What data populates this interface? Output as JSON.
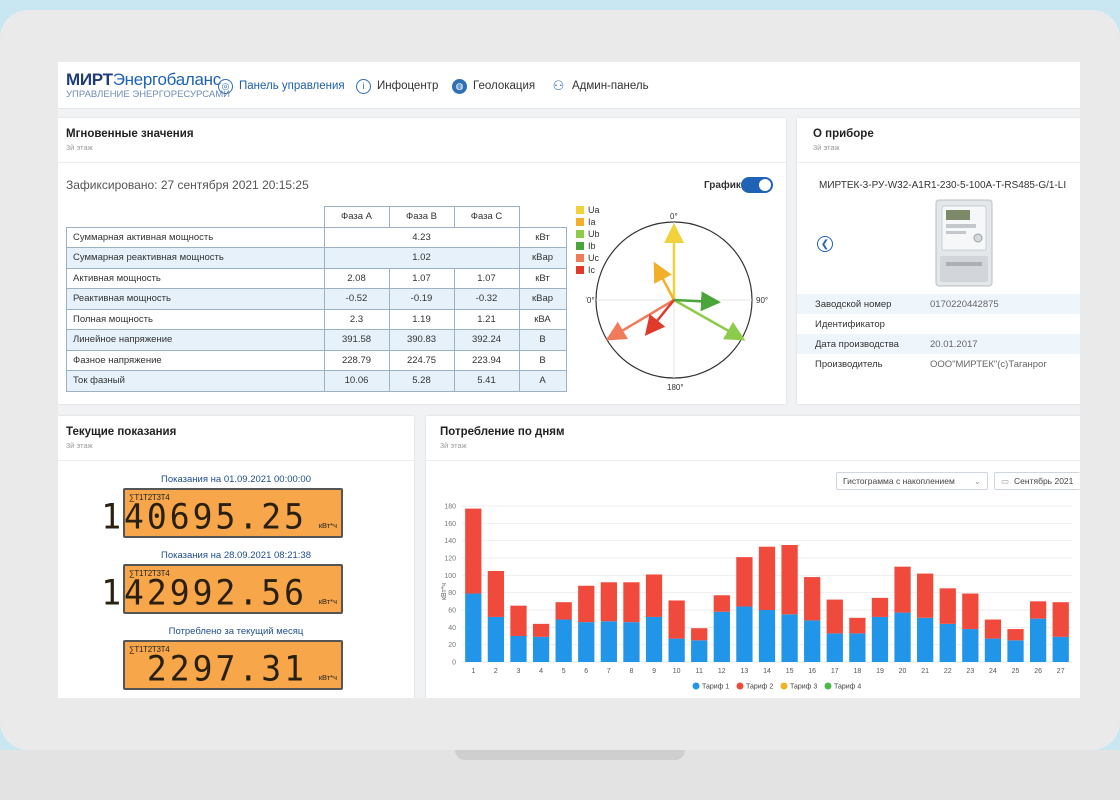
{
  "brand": {
    "name_bold": "МИРТ",
    "name_rest": "Энергобаланс",
    "tagline": "УПРАВЛЕНИЕ ЭНЕРГОРЕСУРСАМИ"
  },
  "nav": [
    {
      "label": "Панель управления",
      "icon": "dashboard-icon"
    },
    {
      "label": "Инфоцентр",
      "icon": "info-icon"
    },
    {
      "label": "Геолокация",
      "icon": "globe-icon"
    },
    {
      "label": "Админ-панель",
      "icon": "users-icon"
    }
  ],
  "instant": {
    "title": "Мгновенные значения",
    "subtitle": "3й этаж",
    "fixed": "Зафиксировано: 27 сентября 2021 20:15:25",
    "graph_label": "График",
    "graph_on": true,
    "headers": [
      "Фаза А",
      "Фаза В",
      "Фаза С"
    ],
    "rows": [
      {
        "name": "Суммарная активная мощность",
        "total": "4.23",
        "unit": "кВт"
      },
      {
        "name": "Суммарная реактивная мощность",
        "total": "1.02",
        "unit": "кВар"
      },
      {
        "name": "Активная мощность",
        "a": "2.08",
        "b": "1.07",
        "c": "1.07",
        "unit": "кВт"
      },
      {
        "name": "Реактивная мощность",
        "a": "-0.52",
        "b": "-0.19",
        "c": "-0.32",
        "unit": "кВар"
      },
      {
        "name": "Полная мощность",
        "a": "2.3",
        "b": "1.19",
        "c": "1.21",
        "unit": "кВА"
      },
      {
        "name": "Линейное напряжение",
        "a": "391.58",
        "b": "390.83",
        "c": "392.24",
        "unit": "В"
      },
      {
        "name": "Фазное напряжение",
        "a": "228.79",
        "b": "224.75",
        "c": "223.94",
        "unit": "В"
      },
      {
        "name": "Ток фазный",
        "a": "10.06",
        "b": "5.28",
        "c": "5.41",
        "unit": "А"
      }
    ],
    "vector_legend": [
      {
        "label": "Ua",
        "color": "#f2d23a"
      },
      {
        "label": "Ia",
        "color": "#f2b02a"
      },
      {
        "label": "Ub",
        "color": "#8ccc4a"
      },
      {
        "label": "Ib",
        "color": "#49a53a"
      },
      {
        "label": "Uc",
        "color": "#f07a5a"
      },
      {
        "label": "Ic",
        "color": "#e03a2a"
      }
    ],
    "vector_angles": [
      "0°",
      "90°",
      "180°",
      "270°"
    ]
  },
  "device": {
    "title": "О приборе",
    "subtitle": "3й этаж",
    "model": "МИРТЕК-3-РУ-W32-A1R1-230-5-100A-T-RS485-G/1-LI",
    "fields": [
      {
        "key": "Заводской номер",
        "value": "0170220442875"
      },
      {
        "key": "Идентификатор",
        "value": ""
      },
      {
        "key": "Дата производства",
        "value": "20.01.2017"
      },
      {
        "key": "Производитель",
        "value": "ООО\"МИРТЕК\"(с)Таганрог"
      }
    ]
  },
  "readings": {
    "title": "Текущие показания",
    "subtitle": "3й этаж",
    "items": [
      {
        "label": "Показания на 01.09.2021 00:00:00",
        "tariff": "∑T1T2T3T4",
        "value": "140695.25",
        "unit": "кВт*ч"
      },
      {
        "label": "Показания на 28.09.2021 08:21:38",
        "tariff": "∑T1T2T3T4",
        "value": "142992.56",
        "unit": "кВт*ч"
      },
      {
        "label": "Потреблено за текущий месяц",
        "tariff": "∑T1T2T3T4",
        "value": "2297.31",
        "unit": "кВт*ч"
      }
    ]
  },
  "consumption": {
    "title": "Потребление по дням",
    "subtitle": "3й этаж",
    "chart_type_select": "Гистограмма с накоплением",
    "month_select": "Сентябрь 2021",
    "colors": {
      "t1": "#2196e8",
      "t2": "#f04a3c",
      "t3": "#f2b022",
      "t4": "#4cb848"
    }
  },
  "chart_data": {
    "type": "bar",
    "stacked": true,
    "categories": [
      "1",
      "2",
      "3",
      "4",
      "5",
      "6",
      "7",
      "8",
      "9",
      "10",
      "11",
      "12",
      "13",
      "14",
      "15",
      "16",
      "17",
      "18",
      "19",
      "20",
      "21",
      "22",
      "23",
      "24",
      "25",
      "26",
      "27"
    ],
    "series": [
      {
        "name": "Тариф 1",
        "values": [
          79,
          52,
          30,
          29,
          49,
          46,
          47,
          46,
          52,
          27,
          25,
          58,
          64,
          60,
          55,
          48,
          33,
          33,
          52,
          57,
          51,
          44,
          38,
          27,
          25,
          50,
          29
        ]
      },
      {
        "name": "Тариф 2",
        "values": [
          98,
          53,
          35,
          15,
          20,
          42,
          45,
          46,
          49,
          44,
          14,
          19,
          57,
          73,
          80,
          50,
          39,
          18,
          22,
          53,
          51,
          41,
          41,
          22,
          13,
          20,
          40
        ]
      },
      {
        "name": "Тариф 3",
        "values": [
          0,
          0,
          0,
          0,
          0,
          0,
          0,
          0,
          0,
          0,
          0,
          0,
          0,
          0,
          0,
          0,
          0,
          0,
          0,
          0,
          0,
          0,
          0,
          0,
          0,
          0,
          0
        ]
      },
      {
        "name": "Тариф 4",
        "values": [
          0,
          0,
          0,
          0,
          0,
          0,
          0,
          0,
          0,
          0,
          0,
          0,
          0,
          0,
          0,
          0,
          0,
          0,
          0,
          0,
          0,
          0,
          0,
          0,
          0,
          0,
          0
        ]
      }
    ],
    "ylabel": "кВт*ч",
    "ylim": [
      0,
      180
    ],
    "yticks": [
      "0",
      "20",
      "40",
      "60",
      "80",
      "100",
      "120",
      "140",
      "160",
      "180"
    ],
    "grid": true,
    "legend": "bottom"
  }
}
